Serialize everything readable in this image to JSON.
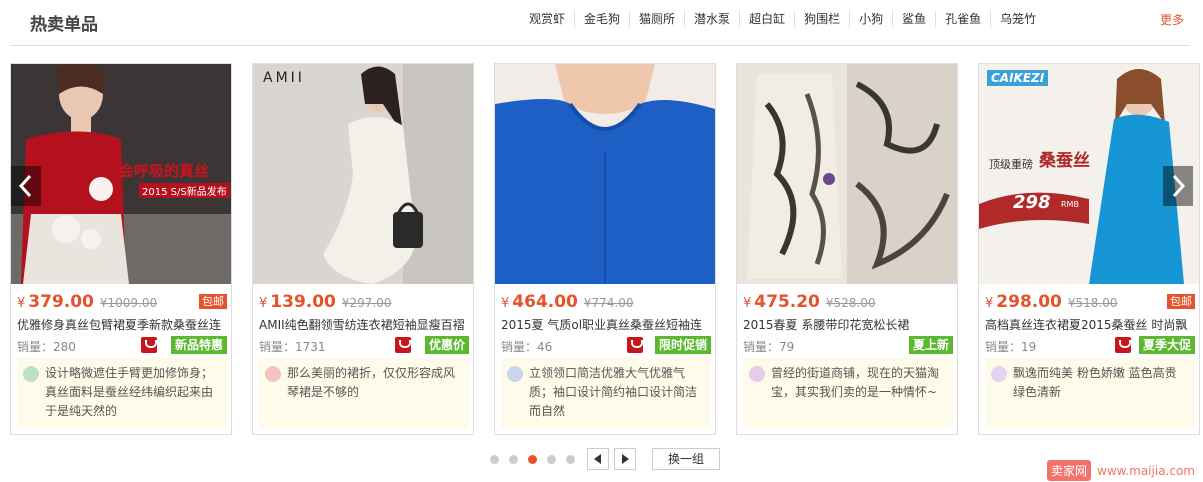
{
  "header": {
    "title": "热卖单品",
    "tags": [
      "观赏虾",
      "金毛狗",
      "猫厕所",
      "潜水泵",
      "超白缸",
      "狗围栏",
      "小狗",
      "鲨鱼",
      "孔雀鱼",
      "乌笼竹"
    ],
    "more": "更多"
  },
  "colors": {
    "accent": "#e4532b",
    "promo": "#5cb82f",
    "review_bg": "#fffbea"
  },
  "products": [
    {
      "currency": "¥",
      "price": "379.00",
      "original_price": "¥1009.00",
      "free_shipping": "包邮",
      "name": "优雅修身真丝包臂裙夏季新款桑蚕丝连",
      "sales": "销量：280",
      "promo": "新品特惠",
      "review": "设计略微遮住手臂更加修饰身；真丝面料是蚕丝经纬编织起来由于是纯天然的",
      "image_text": [
        "会呼吸的真丝",
        "2015 S/S新品发布"
      ]
    },
    {
      "currency": "¥",
      "price": "139.00",
      "original_price": "¥297.00",
      "free_shipping": "",
      "name": "AMII纯色翻领雪纺连衣裙短袖显瘦百褶",
      "sales": "销量：1731",
      "promo": "优惠价",
      "review": "那么美丽的裙折，仅仅形容成风琴裙是不够的",
      "image_text": [
        "AMII"
      ]
    },
    {
      "currency": "¥",
      "price": "464.00",
      "original_price": "¥774.00",
      "free_shipping": "",
      "name": "2015夏 气质ol职业真丝桑蚕丝短袖连",
      "sales": "销量：46",
      "promo": "限时促销",
      "review": "立领领口简洁优雅大气优雅气质；袖口设计简约袖口设计简洁而自然",
      "image_text": []
    },
    {
      "currency": "¥",
      "price": "475.20",
      "original_price": "¥528.00",
      "free_shipping": "",
      "name": "2015春夏 系腰带印花宽松长裙",
      "sales": "销量：79",
      "promo": "夏上新",
      "review": "曾经的街道商铺，现在的天猫淘宝，其实我们卖的是一种情怀~",
      "image_text": []
    },
    {
      "currency": "¥",
      "price": "298.00",
      "original_price": "¥518.00",
      "free_shipping": "包邮",
      "name": "高档真丝连衣裙夏2015桑蚕丝 时尚飘",
      "sales": "销量：19",
      "promo": "夏季大促",
      "review": "飘逸而纯美 粉色娇嫩 蓝色高贵 绿色清新",
      "image_text": [
        "CAIKEZI",
        "顶级重磅",
        "桑蚕丝",
        "298",
        "RMB"
      ]
    }
  ],
  "pager": {
    "dots": 5,
    "active_dot": 3,
    "swap_label": "换一组"
  },
  "watermark": {
    "logo": "卖家网",
    "url": "www.maijia.com"
  }
}
